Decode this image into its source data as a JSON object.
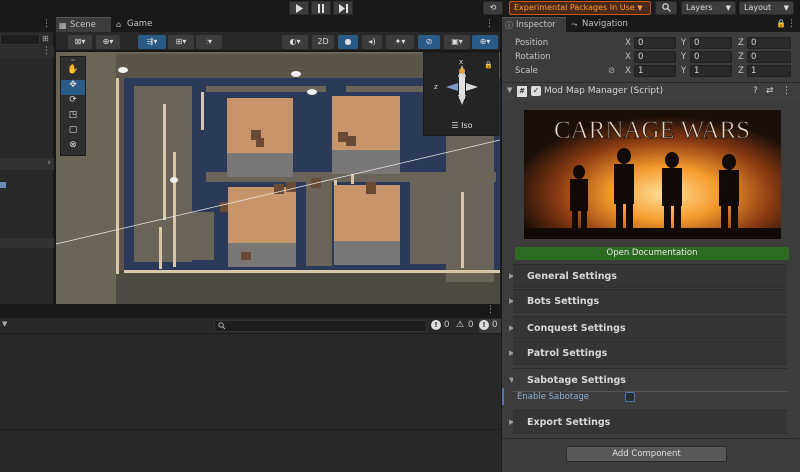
{
  "toolbar": {
    "play_icon": "play-icon",
    "pause_icon": "pause-icon",
    "step_icon": "step-icon",
    "experimental": "Experimental Packages In Use",
    "layers": "Layers",
    "layout": "Layout"
  },
  "scene_tabs": {
    "scene": "Scene",
    "game": "Game"
  },
  "scene_toolbar": {
    "mode_2d": "2D"
  },
  "gizmo": {
    "iso": "Iso",
    "x": "x",
    "z": "z"
  },
  "inspector_tabs": {
    "inspector": "Inspector",
    "navigation": "Navigation"
  },
  "transform": {
    "position": {
      "label": "Position",
      "x": "0",
      "y": "0",
      "z": "0"
    },
    "rotation": {
      "label": "Rotation",
      "x": "0",
      "y": "0",
      "z": "0"
    },
    "scale": {
      "label": "Scale",
      "x": "1",
      "y": "1",
      "z": "1"
    },
    "axis_x": "X",
    "axis_y": "Y",
    "axis_z": "Z"
  },
  "component": {
    "name": "Mod Map Manager (Script)",
    "banner_title": "CARNAGE WARS",
    "open_doc": "Open Documentation",
    "sections": [
      {
        "title": "General Settings"
      },
      {
        "title": "Bots Settings"
      },
      {
        "title": "Conquest Settings"
      },
      {
        "title": "Patrol Settings"
      },
      {
        "title": "Sabotage Settings"
      },
      {
        "title": "Export Settings"
      }
    ],
    "enable_sabotage": "Enable Sabotage",
    "enable_sabotage_checked": false
  },
  "add_component": "Add Component",
  "console": {
    "errors": "0",
    "warnings": "0",
    "infos": "0"
  },
  "colors": {
    "accent": "#ff9a3c",
    "doc_button": "#2e6b22",
    "selected_tool": "#2a5a86"
  }
}
